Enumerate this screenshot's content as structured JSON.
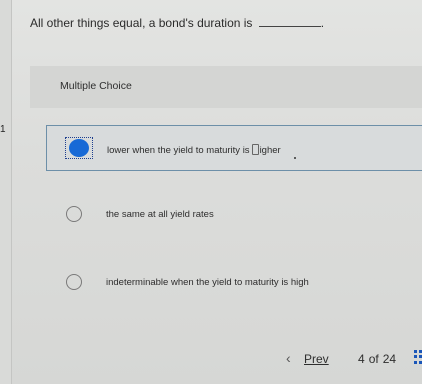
{
  "question": {
    "number": "1",
    "text": "All other things equal, a bond's duration is",
    "end_punct": "."
  },
  "section": {
    "label": "Multiple Choice"
  },
  "options": [
    {
      "text_before_cursor": "lower when the yield to maturity is",
      "text_after_cursor": "igher",
      "selected": true
    },
    {
      "text": "the same at all yield rates",
      "selected": false
    },
    {
      "text": "indeterminable when the yield to maturity is high",
      "selected": false
    }
  ],
  "pagination": {
    "prev_label": "Prev",
    "current": "4",
    "of_label": "of",
    "total": "24"
  },
  "colors": {
    "selected_radio": "#1769d6",
    "selected_border": "#6d8fa8",
    "grid_icon": "#1a56b8"
  },
  "icons": {
    "prev": "chevron-left-icon",
    "grid": "grid-icon"
  }
}
